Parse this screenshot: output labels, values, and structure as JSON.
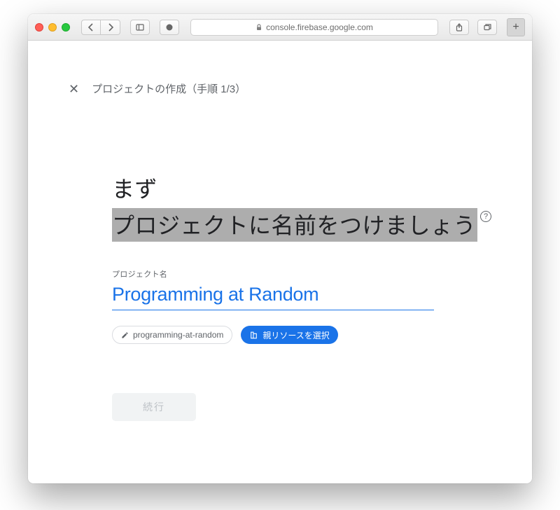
{
  "browser": {
    "url": "console.firebase.google.com"
  },
  "header": {
    "title": "プロジェクトの作成（手順 1/3）"
  },
  "heading": {
    "line1": "まず",
    "line2": "プロジェクトに名前をつけましょう"
  },
  "form": {
    "project_name_label": "プロジェクト名",
    "project_name_value": "Programming at Random",
    "slug_value": "programming-at-random",
    "parent_resource_label": "親リソースを選択",
    "continue_label": "続行"
  }
}
